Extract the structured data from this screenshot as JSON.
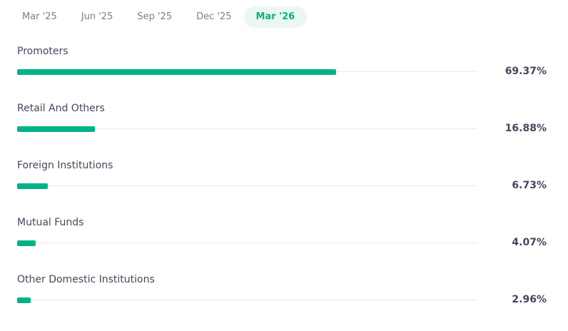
{
  "tabs": [
    {
      "label": "Mar '25",
      "active": false
    },
    {
      "label": "Jun '25",
      "active": false
    },
    {
      "label": "Sep '25",
      "active": false
    },
    {
      "label": "Dec '25",
      "active": false
    },
    {
      "label": "Mar '26",
      "active": true
    }
  ],
  "holdings": [
    {
      "label": "Promoters",
      "value_text": "69.37%",
      "value": 69.37
    },
    {
      "label": "Retail And Others",
      "value_text": "16.88%",
      "value": 16.88
    },
    {
      "label": "Foreign Institutions",
      "value_text": "6.73%",
      "value": 6.73
    },
    {
      "label": "Mutual Funds",
      "value_text": "4.07%",
      "value": 4.07
    },
    {
      "label": "Other Domestic Institutions",
      "value_text": "2.96%",
      "value": 2.96
    }
  ],
  "colors": {
    "accent": "#00b386",
    "active_tab_bg": "#ebf8f2",
    "track": "#e9e9eb"
  }
}
